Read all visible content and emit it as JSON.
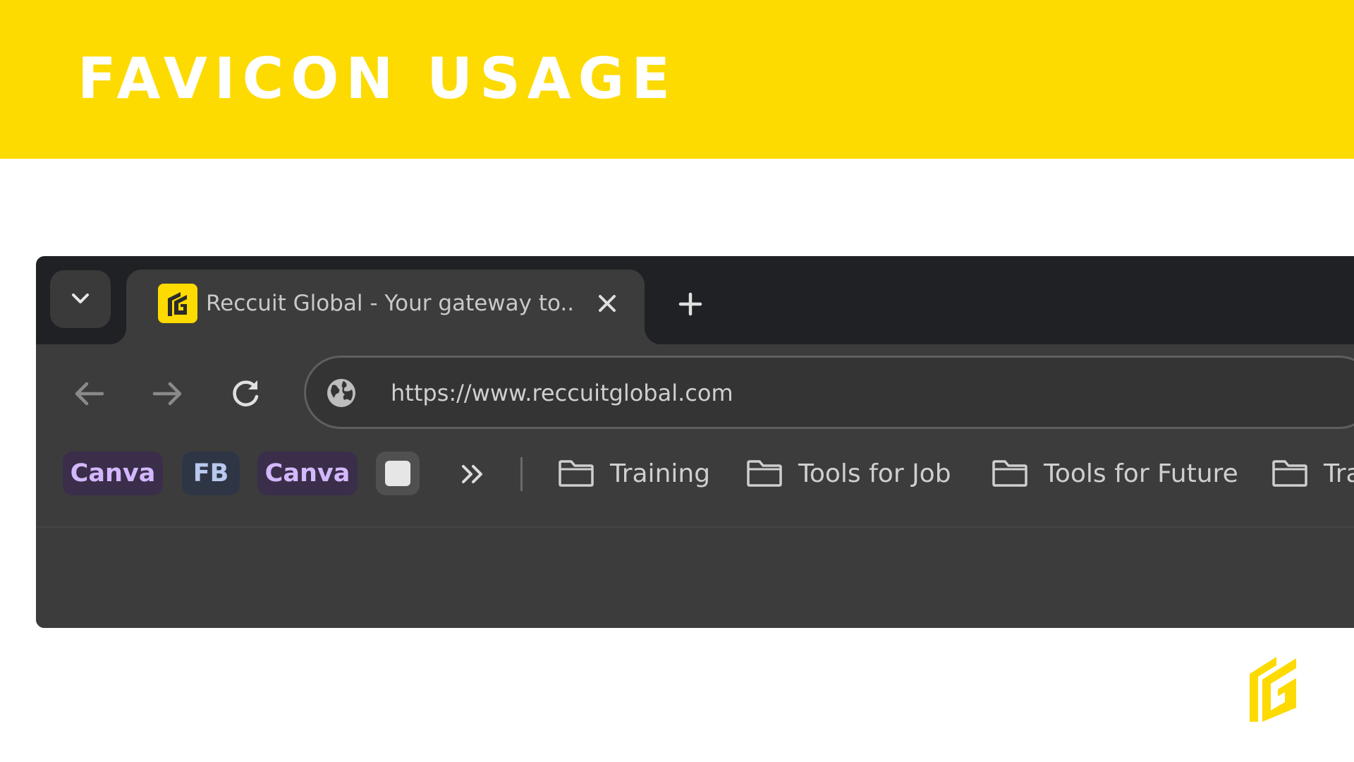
{
  "slide": {
    "title": "FAVICON USAGE",
    "brand_color": "#FDDA00"
  },
  "browser": {
    "tab": {
      "title": "Reccuit Global - Your gateway to...",
      "favicon": "reccuit-global-logo"
    },
    "address_bar": {
      "url": "https://www.reccuitglobal.com",
      "site_icon": "globe-icon"
    },
    "bookmarks": {
      "items": [
        {
          "label": "Canva",
          "style": "canva"
        },
        {
          "label": "FB",
          "style": "fb"
        },
        {
          "label": "Canva",
          "style": "canva"
        },
        {
          "label": "",
          "style": "blank"
        }
      ],
      "folders": [
        {
          "label": "Training"
        },
        {
          "label": "Tools for Job"
        },
        {
          "label": "Tools for Future"
        },
        {
          "label": "Tra"
        }
      ],
      "overflow_icon": "double-chevron-icon"
    },
    "icons": {
      "tab_search": "chevron-down-icon",
      "close_tab": "close-icon",
      "new_tab": "plus-icon",
      "back": "arrow-left-icon",
      "forward": "arrow-right-icon",
      "reload": "reload-icon",
      "folder": "folder-icon"
    }
  }
}
